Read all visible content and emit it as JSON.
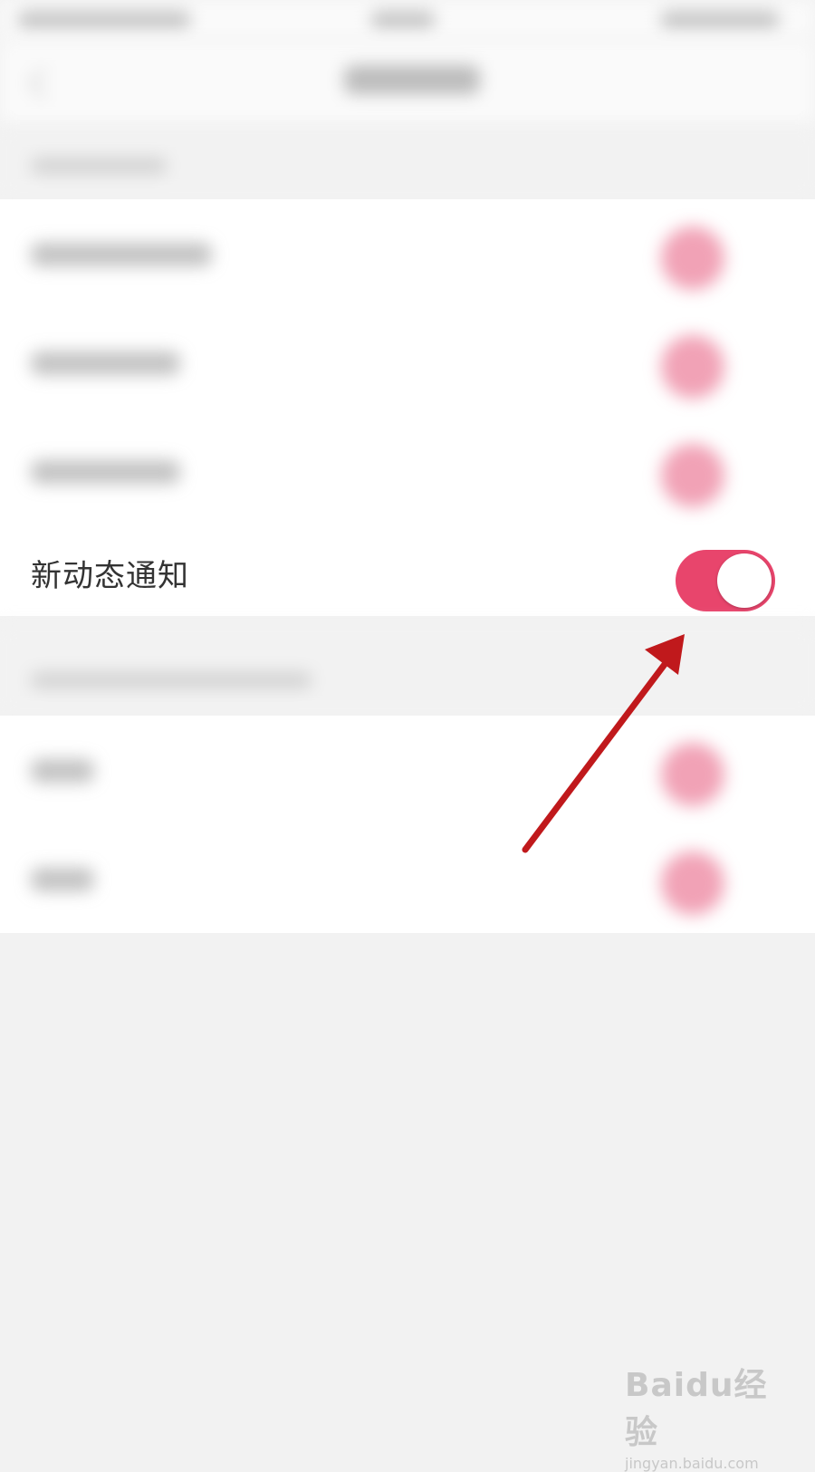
{
  "settings": {
    "active_row": {
      "label": "新动态通知",
      "toggle_on": true
    }
  },
  "colors": {
    "accent": "#e8456c",
    "annotation_arrow": "#c0191c",
    "background": "#f2f2f2",
    "row_background": "#ffffff"
  },
  "watermark": {
    "brand": "Baidu经验",
    "url": "jingyan.baidu.com"
  }
}
